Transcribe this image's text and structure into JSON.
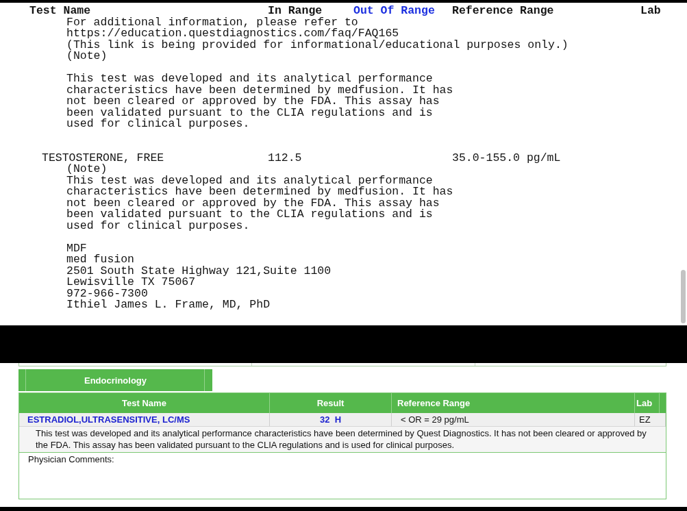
{
  "text_report": {
    "columns": [
      {
        "label": "Test Name",
        "kind": "name"
      },
      {
        "label": "In Range",
        "kind": "in_range"
      },
      {
        "label": "Out Of Range",
        "kind": "out_of_range"
      },
      {
        "label": "Reference Range",
        "kind": "reference"
      },
      {
        "label": "Lab",
        "kind": "lab"
      }
    ],
    "entries": [
      {
        "kind": "note",
        "text": "For additional information, please refer to\nhttps://education.questdiagnostics.com/faq/FAQ165\n(This link is being provided for informational/educational purposes only.)\n(Note)"
      },
      {
        "kind": "note",
        "text": "This test was developed and its analytical performance\ncharacteristics have been determined by medfusion. It has\nnot been cleared or approved by the FDA. This assay has\nbeen validated pursuant to the CLIA regulations and is\nused for clinical purposes."
      },
      {
        "kind": "result",
        "test_name": "TESTOSTERONE, FREE",
        "in_range": "112.5",
        "reference_range": "35.0-155.0 pg/mL"
      },
      {
        "kind": "note",
        "text": "(Note)\nThis test was developed and its analytical performance\ncharacteristics have been determined by medfusion. It has\nnot been cleared or approved by the FDA. This assay has\nbeen validated pursuant to the CLIA regulations and is\nused for clinical purposes."
      },
      {
        "kind": "address",
        "text": "MDF\nmed fusion\n2501 South State Highway 121,Suite 1100\nLewisville TX 75067\n972-966-7300\nIthiel James L. Frame, MD, PhD"
      }
    ]
  },
  "endocrinology_panel": {
    "section_title": "Endocrinology",
    "columns": [
      {
        "label": "Test Name",
        "kind": "name"
      },
      {
        "label": "Result",
        "kind": "result"
      },
      {
        "label": "Reference Range",
        "kind": "reference"
      },
      {
        "label": "Lab",
        "kind": "lab"
      }
    ],
    "rows": [
      {
        "test_name": "ESTRADIOL,ULTRASENSITIVE, LC/MS",
        "result": "32  H",
        "flagged": true,
        "reference_range": "< OR = 29 pg/mL",
        "lab": "EZ",
        "comment": "This test was developed and its analytical performance characteristics have been determined by Quest Diagnostics. It has not been cleared or approved by the FDA. This assay has been validated pursuant to the CLIA regulations and is used for clinical purposes."
      }
    ],
    "physician_comments_label": "Physician Comments:"
  }
}
